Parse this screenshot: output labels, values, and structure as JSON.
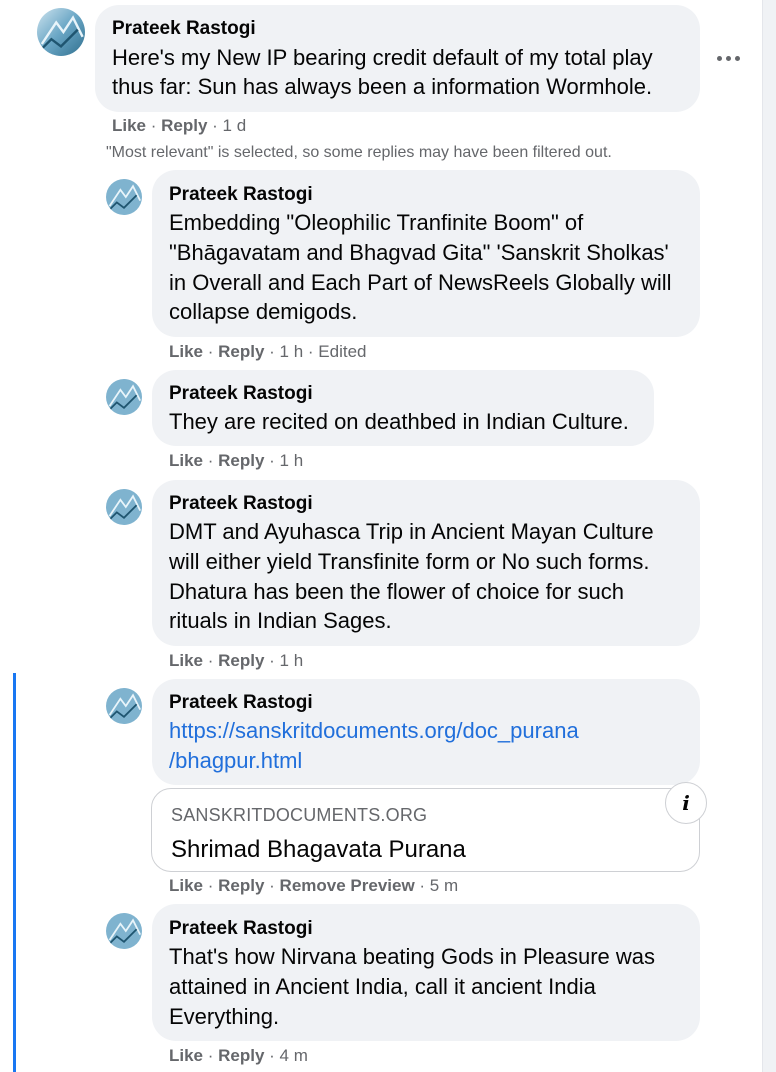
{
  "comment": {
    "author": "Prateek Rastogi",
    "lines": [
      "Here's my New IP bearing credit default of my total play",
      "thus far: Sun has always been a information Wormhole."
    ],
    "like": "Like",
    "reply": "Reply",
    "time": "1 d",
    "more_icon": "more-horizontal-icon"
  },
  "filtered_note": "\"Most relevant\" is selected, so some replies may have been filtered out.",
  "replies": [
    {
      "author": "Prateek Rastogi",
      "lines": [
        "Embedding \"Oleophilic Tranfinite Boom\" of",
        "\"Bhāgavatam and Bhagvad Gita\" 'Sanskrit Sholkas'",
        "in Overall and Each Part of NewsReels Globally will",
        "collapse demigods."
      ],
      "like": "Like",
      "reply": "Reply",
      "time": "1 h",
      "edited": "Edited"
    },
    {
      "author": "Prateek Rastogi",
      "lines": [
        "They are recited on deathbed in Indian Culture."
      ],
      "like": "Like",
      "reply": "Reply",
      "time": "1 h"
    },
    {
      "author": "Prateek Rastogi",
      "lines": [
        "DMT and Ayuhasca Trip in Ancient Mayan Culture",
        "will either yield Transfinite form or No such forms.",
        "Dhatura has been the flower of choice for such",
        "rituals in Indian Sages."
      ],
      "like": "Like",
      "reply": "Reply",
      "time": "1 h"
    },
    {
      "author": "Prateek Rastogi",
      "link_lines": [
        "https://sanskritdocuments.org/doc_purana",
        "/bhagpur.html"
      ],
      "preview": {
        "domain": "SANSKRITDOCUMENTS.ORG",
        "title": "Shrimad Bhagavata Purana",
        "info_icon": "info-icon"
      },
      "like": "Like",
      "reply": "Reply",
      "remove_preview": "Remove Preview",
      "time": "5 m"
    },
    {
      "author": "Prateek Rastogi",
      "lines": [
        "That's how Nirvana beating Gods in Pleasure was",
        "attained in Ancient India, call it ancient India",
        "Everything."
      ],
      "like": "Like",
      "reply": "Reply",
      "time": "4 m"
    }
  ],
  "colors": {
    "bubble": "#f0f2f5",
    "link": "#216fdb",
    "meta": "#65676b",
    "thread_line": "#1877f2"
  }
}
